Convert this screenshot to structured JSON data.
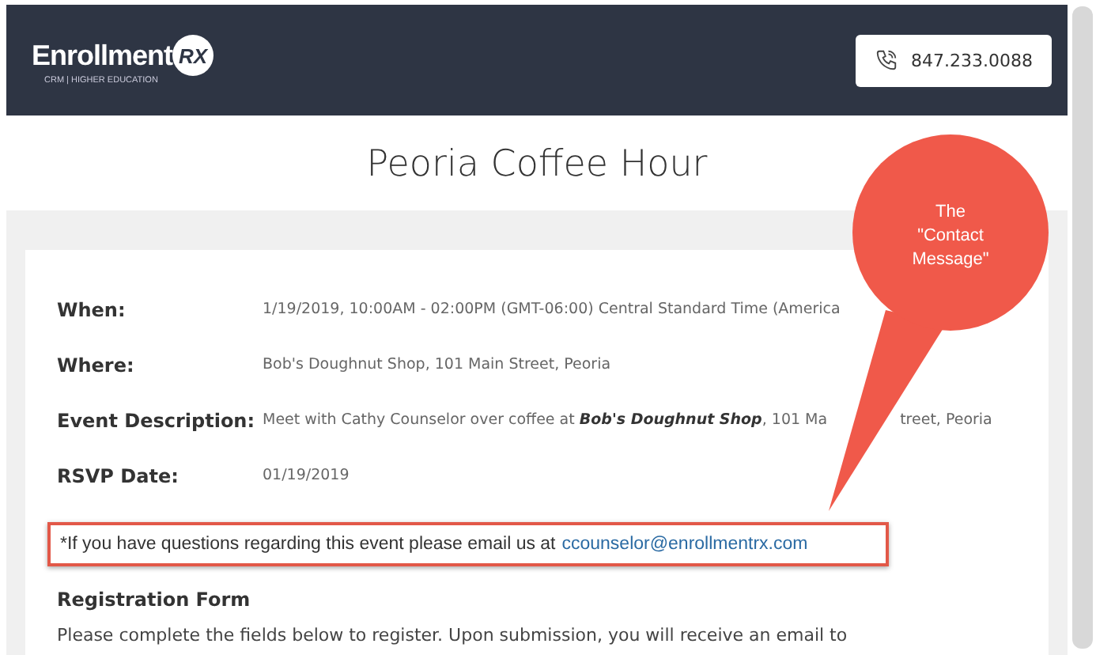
{
  "header": {
    "logo": {
      "name": "Enrollment",
      "mark": "RX",
      "tagline": "CRM | HIGHER EDUCATION"
    },
    "phone": "847.233.0088"
  },
  "page_title": "Peoria Coffee Hour",
  "details": [
    {
      "label": "When:",
      "value": "1/19/2019, 10:00AM - 02:00PM (GMT-06:00) Central Standard Time (America"
    },
    {
      "label": "Where:",
      "value": "Bob's Doughnut Shop, 101 Main Street, Peoria"
    },
    {
      "label": "Event Description:",
      "value": "Meet with Cathy Counselor over coffee at **Bob's Doughnut Shop**, 101 Ma",
      "value_continued": "treet, Peoria"
    },
    {
      "label": "RSVP Date:",
      "value": "01/19/2019"
    }
  ],
  "contact_message": {
    "text": "*If you have questions regarding this event please email us at",
    "email": "ccounselor@enrollmentrx.com",
    "highlighted": true
  },
  "registration": {
    "heading": "Registration Form",
    "intro": "Please complete the fields below to register. Upon submission, you will receive an email to"
  },
  "callout": {
    "lines": [
      "The",
      "\"Contact",
      "Message\""
    ]
  }
}
